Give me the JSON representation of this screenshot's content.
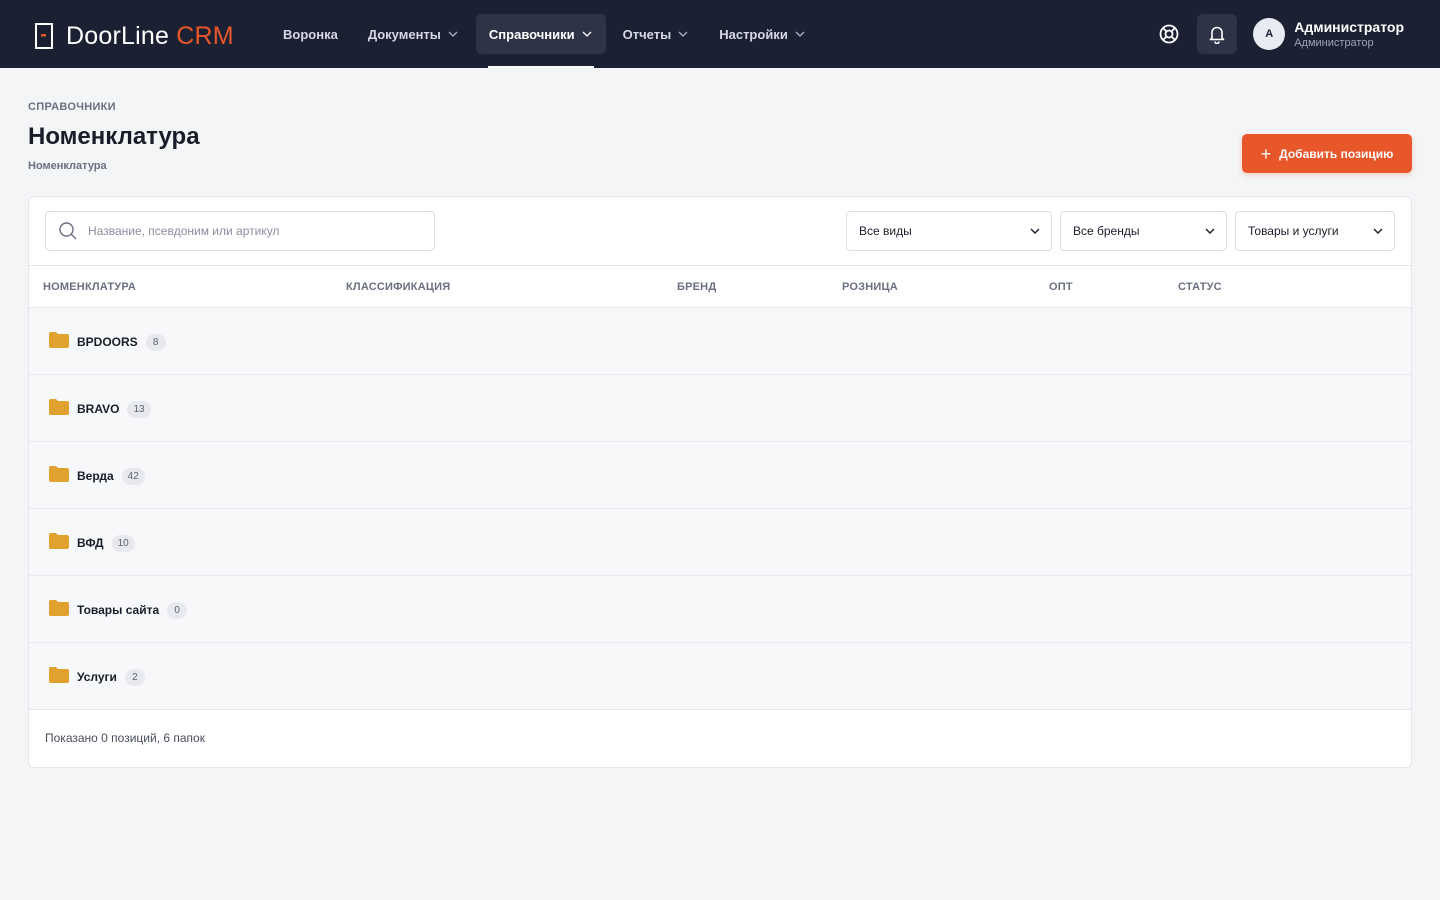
{
  "app": {
    "logo_main": "DoorLine",
    "logo_accent": "CRM",
    "accent_color": "#e8572a"
  },
  "nav": {
    "items": [
      {
        "label": "Воронка",
        "dropdown": false
      },
      {
        "label": "Документы",
        "dropdown": true
      },
      {
        "label": "Справочники",
        "dropdown": true,
        "active": true
      },
      {
        "label": "Отчеты",
        "dropdown": true
      },
      {
        "label": "Настройки",
        "dropdown": true
      }
    ]
  },
  "user": {
    "avatar_initial": "A",
    "name": "Администратор",
    "role": "Администратор"
  },
  "header": {
    "eyebrow": "СПРАВОЧНИКИ",
    "title": "Номенклатура",
    "breadcrumb": "Номенклатура",
    "add_button": "Добавить позицию"
  },
  "filters": {
    "search_placeholder": "Название, псевдоним или артикул",
    "kind": "Все виды",
    "brand": "Все бренды",
    "type": "Товары и услуги"
  },
  "table": {
    "columns": [
      "НОМЕНКЛАТУРА",
      "КЛАССИФИКАЦИЯ",
      "БРЕНД",
      "РОЗНИЦА",
      "ОПТ",
      "СТАТУС"
    ],
    "rows": [
      {
        "name": "BPDOORS",
        "count": "8"
      },
      {
        "name": "BRAVO",
        "count": "13"
      },
      {
        "name": "Верда",
        "count": "42"
      },
      {
        "name": "ВФД",
        "count": "10"
      },
      {
        "name": "Товары сайта",
        "count": "0"
      },
      {
        "name": "Услуги",
        "count": "2"
      }
    ],
    "folder_color": "#e0a12e"
  },
  "footer": {
    "summary": "Показано 0 позиций, 6 папок"
  }
}
